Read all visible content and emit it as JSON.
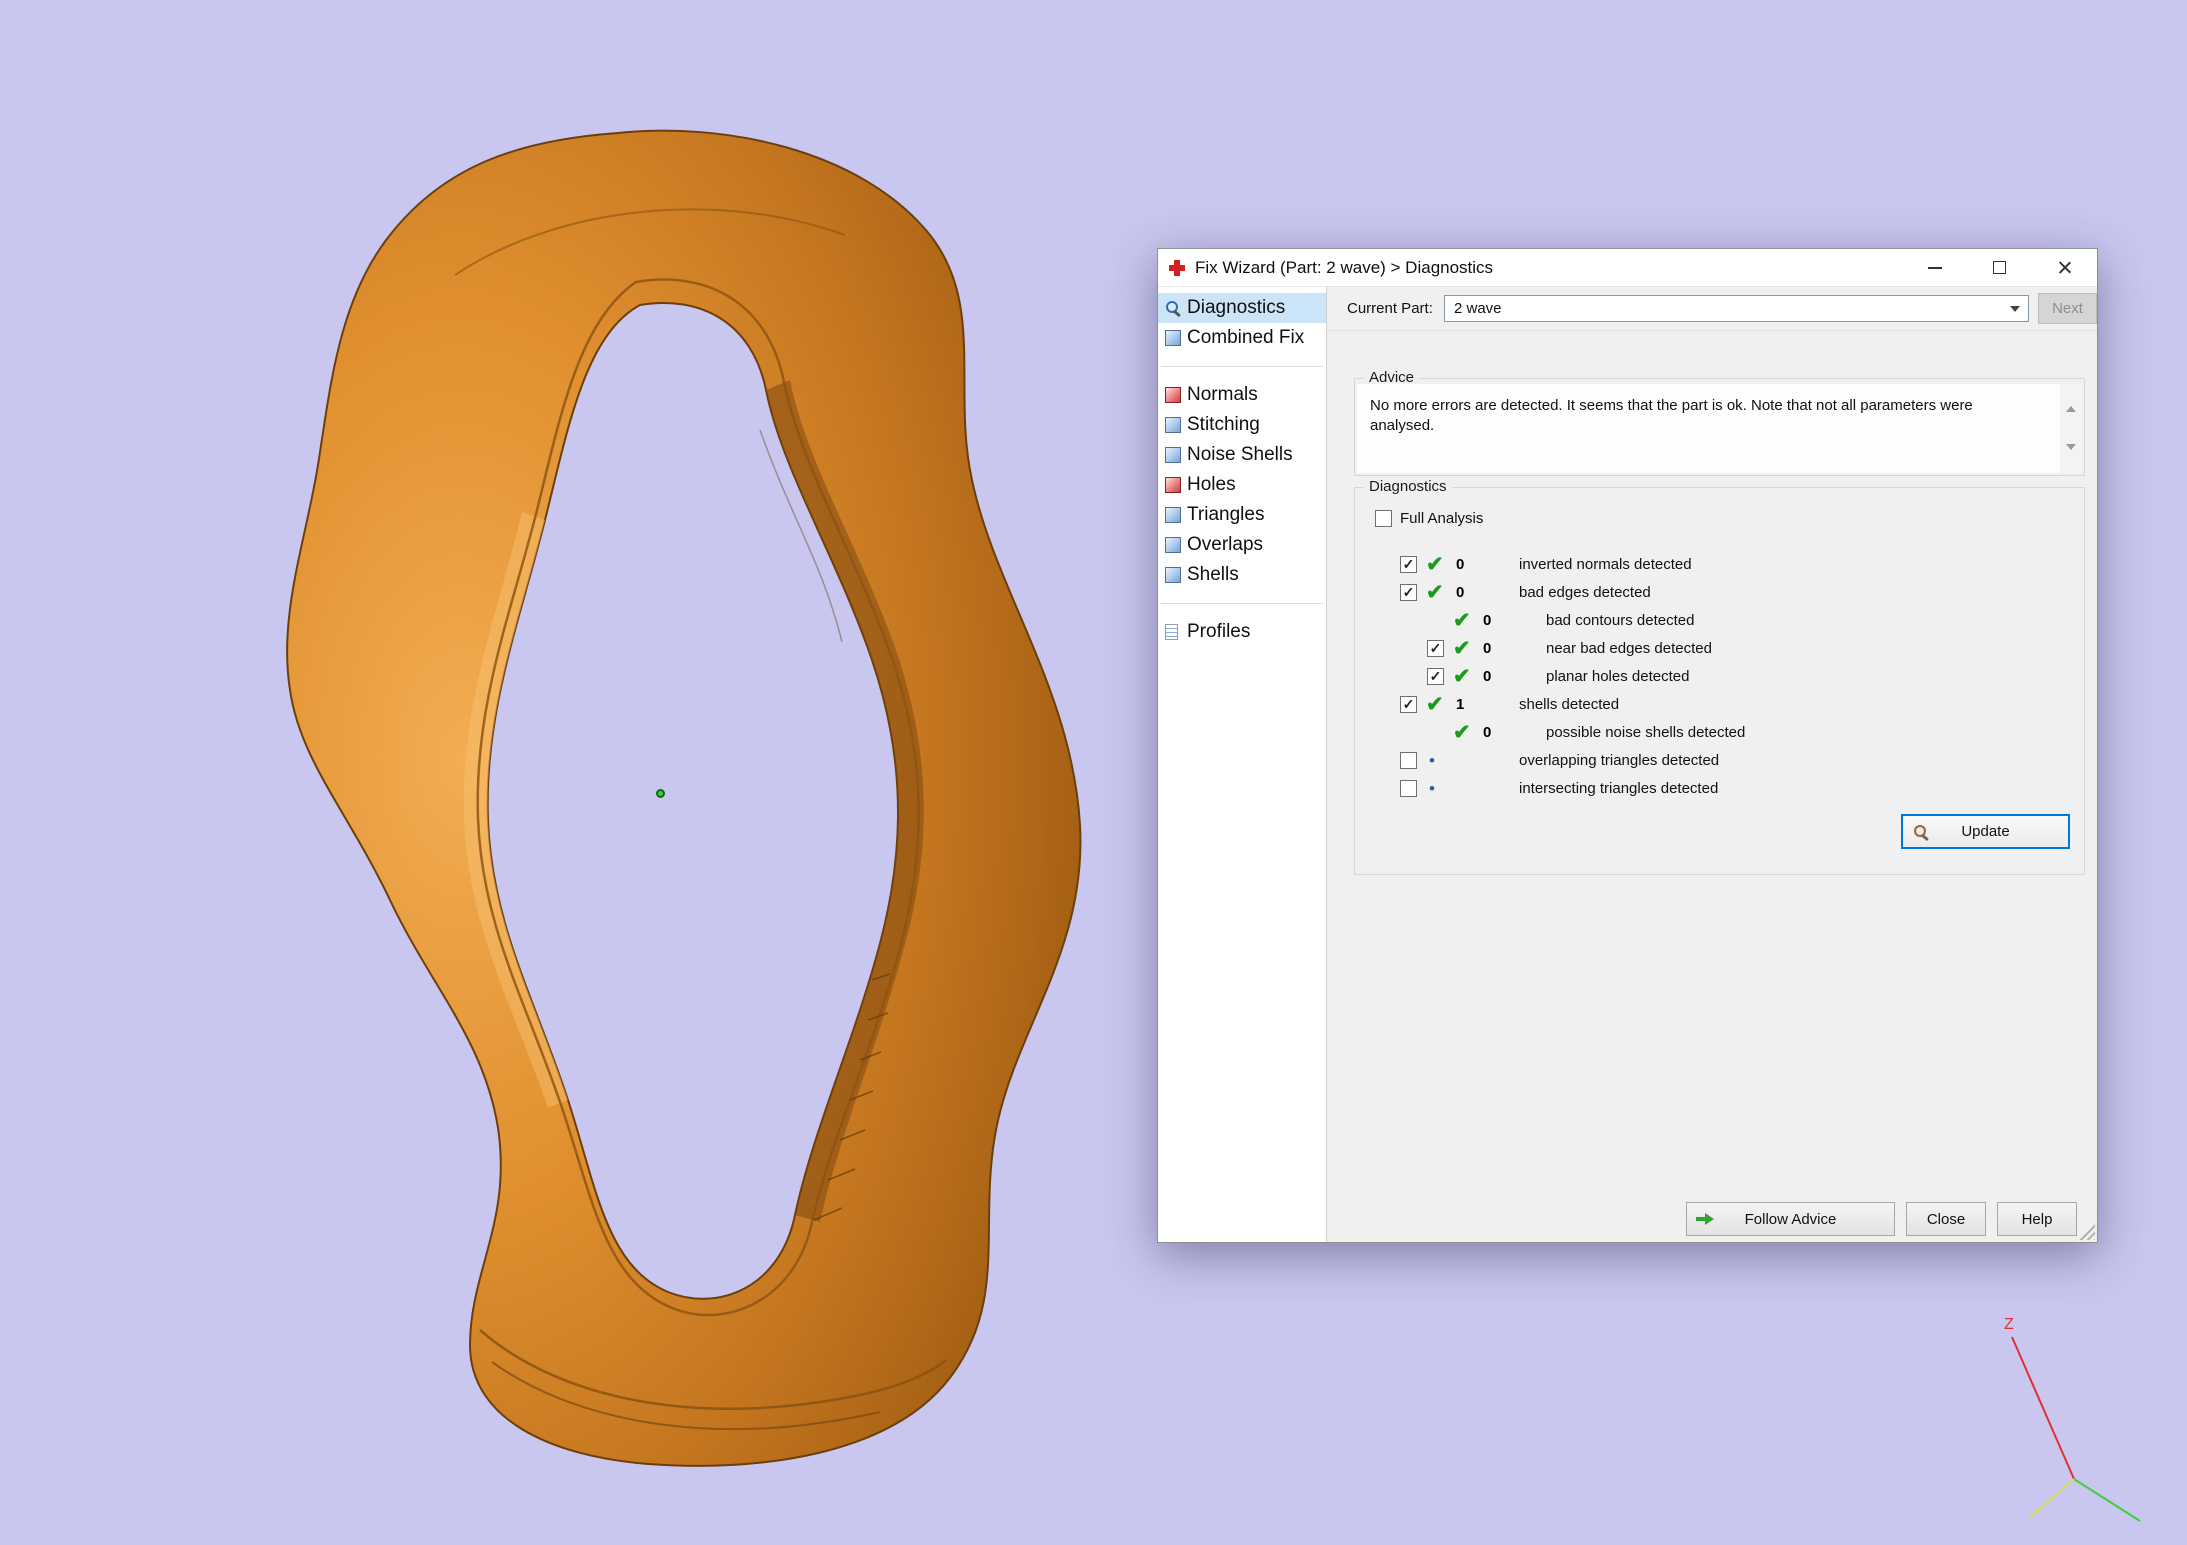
{
  "viewport": {
    "background_color": "#c9c7ef",
    "model_color": "#d9882f",
    "axis": {
      "z_label": "Z"
    }
  },
  "dialog": {
    "title": "Fix Wizard (Part: 2 wave) > Diagnostics",
    "current_part": {
      "label": "Current Part:",
      "value": "2 wave"
    },
    "next_button_label": "Next",
    "colors": {
      "selection": "#cce4f7",
      "check_green": "#1d9b1d",
      "update_focus_border": "#0078d7"
    },
    "sidebar": {
      "groups": [
        {
          "items": [
            {
              "label": "Diagnostics",
              "icon": "magnifier-icon",
              "selected": true
            },
            {
              "label": "Combined Fix",
              "icon": "cube-icon",
              "selected": false
            }
          ]
        },
        {
          "items": [
            {
              "label": "Normals",
              "icon": "cube-red-icon",
              "selected": false
            },
            {
              "label": "Stitching",
              "icon": "cube-icon",
              "selected": false
            },
            {
              "label": "Noise Shells",
              "icon": "cube-icon",
              "selected": false
            },
            {
              "label": "Holes",
              "icon": "cube-red-icon",
              "selected": false
            },
            {
              "label": "Triangles",
              "icon": "cube-icon",
              "selected": false
            },
            {
              "label": "Overlaps",
              "icon": "cube-icon",
              "selected": false
            },
            {
              "label": "Shells",
              "icon": "cube-icon",
              "selected": false
            }
          ]
        },
        {
          "items": [
            {
              "label": "Profiles",
              "icon": "document-icon",
              "selected": false
            }
          ]
        }
      ]
    },
    "advice": {
      "legend": "Advice",
      "text": "No more errors are detected. It seems that the part is ok. Note that not all parameters were analysed."
    },
    "diagnostics": {
      "legend": "Diagnostics",
      "full_analysis": {
        "label": "Full Analysis",
        "checked": false
      },
      "rows": [
        {
          "checkbox": "checked",
          "indent": 0,
          "status": "ok",
          "count": "0",
          "label": "inverted normals detected"
        },
        {
          "checkbox": "checked",
          "indent": 0,
          "status": "ok",
          "count": "0",
          "label": "bad edges detected"
        },
        {
          "checkbox": "none",
          "indent": 1,
          "status": "ok",
          "count": "0",
          "label": "bad contours detected"
        },
        {
          "checkbox": "checked",
          "indent": 1,
          "status": "ok",
          "count": "0",
          "label": "near bad edges detected"
        },
        {
          "checkbox": "checked",
          "indent": 1,
          "status": "ok",
          "count": "0",
          "label": "planar holes detected"
        },
        {
          "checkbox": "checked",
          "indent": 0,
          "status": "ok",
          "count": "1",
          "label": "shells detected"
        },
        {
          "checkbox": "none",
          "indent": 1,
          "status": "ok",
          "count": "0",
          "label": "possible noise shells detected"
        },
        {
          "checkbox": "unchecked",
          "indent": 0,
          "status": "pending",
          "count": "",
          "label": "overlapping triangles detected"
        },
        {
          "checkbox": "unchecked",
          "indent": 0,
          "status": "pending",
          "count": "",
          "label": "intersecting triangles detected"
        }
      ],
      "update_button_label": "Update"
    },
    "footer": {
      "follow_advice_label": "Follow Advice",
      "close_label": "Close",
      "help_label": "Help"
    }
  }
}
